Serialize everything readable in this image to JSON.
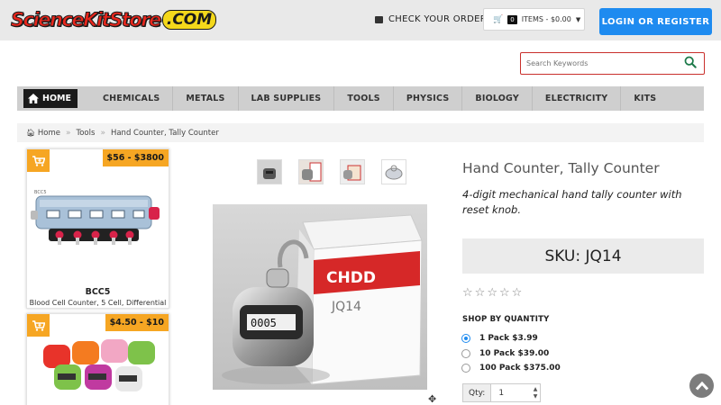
{
  "header": {
    "logo_text": "ScienceKitStore",
    "logo_suffix": ".COM",
    "check_order": "CHECK YOUR ORDER",
    "cart_count": "0",
    "cart_label": "ITEMS - $0.00",
    "login_label": "LOGIN OR REGISTER"
  },
  "search": {
    "placeholder": "Search Keywords"
  },
  "nav": {
    "home": "HOME",
    "items": [
      "CHEMICALS",
      "METALS",
      "LAB SUPPLIES",
      "TOOLS",
      "PHYSICS",
      "BIOLOGY",
      "ELECTRICITY",
      "KITS"
    ]
  },
  "breadcrumb": {
    "home": "Home",
    "tools": "Tools",
    "current": "Hand Counter, Tally Counter"
  },
  "sidebar": {
    "cards": [
      {
        "price": "$56 - $3800",
        "sku": "BCC5",
        "desc": "Blood Cell Counter, 5 Cell, Differential",
        "image_label": "BCC5"
      },
      {
        "price": "$4.50 - $10"
      }
    ]
  },
  "product": {
    "title": "Hand Counter, Tally Counter",
    "subtitle": "4-digit mechanical hand tally counter with reset knob.",
    "sku": "SKU: JQ14",
    "rating": 0,
    "box_brand": "CHDD",
    "box_model": "JQ14",
    "counter_digits": "0005",
    "shop_by_quantity": "SHOP BY QUANTITY",
    "options": [
      {
        "label": "1 Pack $3.99",
        "selected": true
      },
      {
        "label": "10 Pack $39.00",
        "selected": false
      },
      {
        "label": "100 Pack $375.00",
        "selected": false
      }
    ],
    "qty_label": "Qty:",
    "qty_value": "1"
  },
  "colors": {
    "accent_blue": "#1e8bf0",
    "orange": "#f6a623",
    "search_border": "#c9302c"
  }
}
